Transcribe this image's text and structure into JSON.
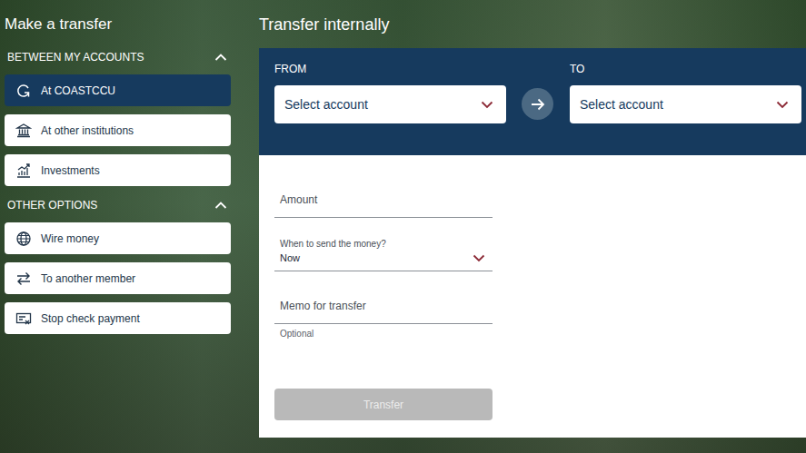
{
  "page": {
    "title": "Make a transfer"
  },
  "sidebar": {
    "sections": [
      {
        "title": "BETWEEN MY ACCOUNTS",
        "expanded": true,
        "items": [
          {
            "label": "At COASTCCU",
            "selected": true
          },
          {
            "label": "At other institutions",
            "selected": false
          },
          {
            "label": "Investments",
            "selected": false
          }
        ]
      },
      {
        "title": "OTHER OPTIONS",
        "expanded": true,
        "items": [
          {
            "label": "Wire money",
            "selected": false
          },
          {
            "label": "To another member",
            "selected": false
          },
          {
            "label": "Stop check payment",
            "selected": false
          }
        ]
      }
    ]
  },
  "transfer": {
    "title": "Transfer internally",
    "from": {
      "label": "FROM",
      "placeholder": "Select account"
    },
    "to": {
      "label": "TO",
      "placeholder": "Select account"
    },
    "fields": [
      {
        "kind": "input",
        "label": "Amount",
        "value": "",
        "hint": ""
      },
      {
        "kind": "select",
        "label": "When to send the money?",
        "value": "Now",
        "hint": ""
      },
      {
        "kind": "input",
        "label": "Memo for transfer",
        "value": "",
        "hint": "Optional"
      }
    ],
    "submit": {
      "label": "Transfer",
      "disabled": true
    }
  }
}
